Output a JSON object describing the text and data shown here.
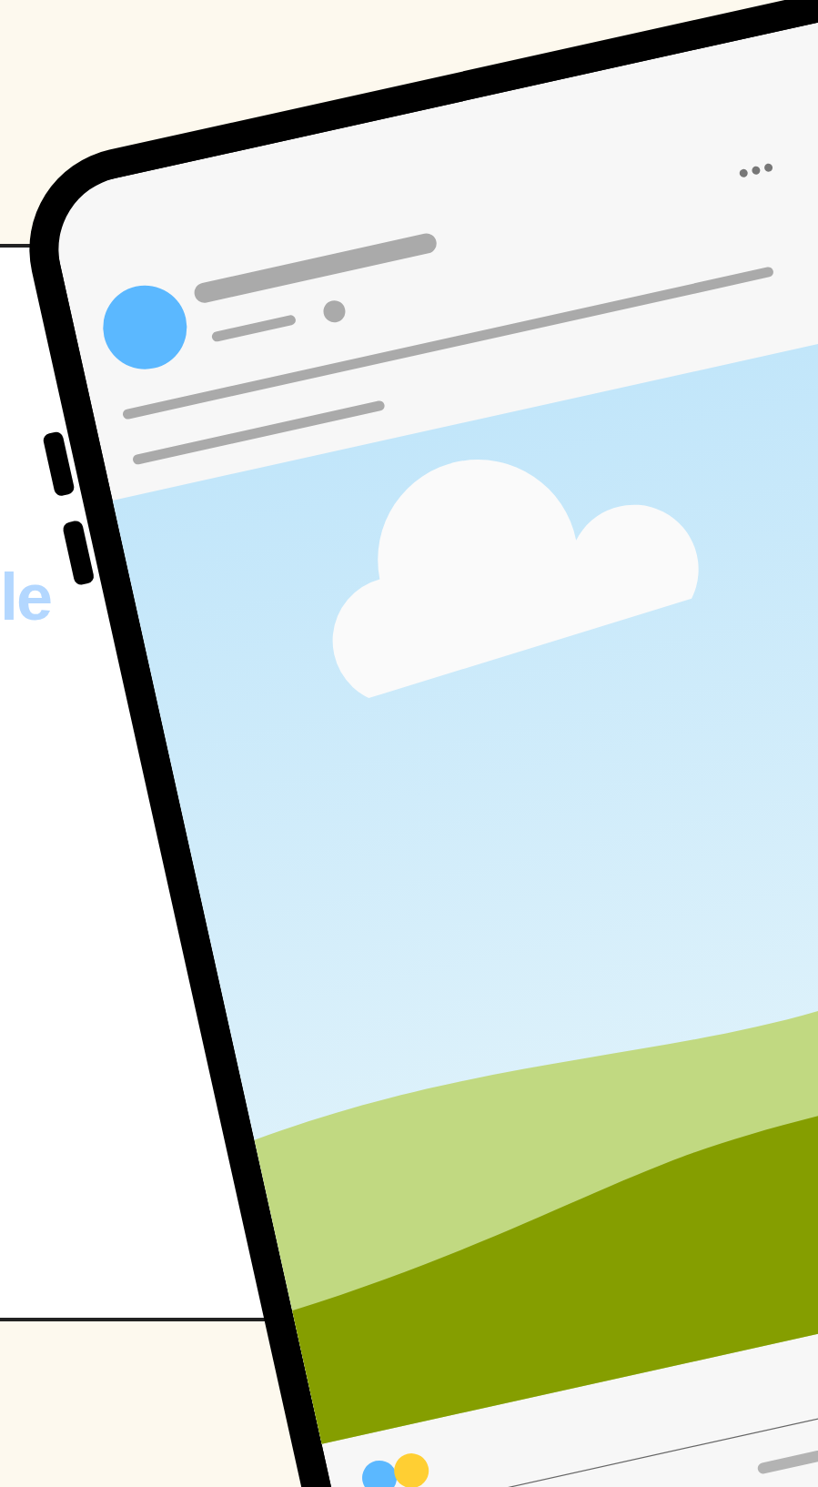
{
  "panel": {
    "heading": "le"
  }
}
